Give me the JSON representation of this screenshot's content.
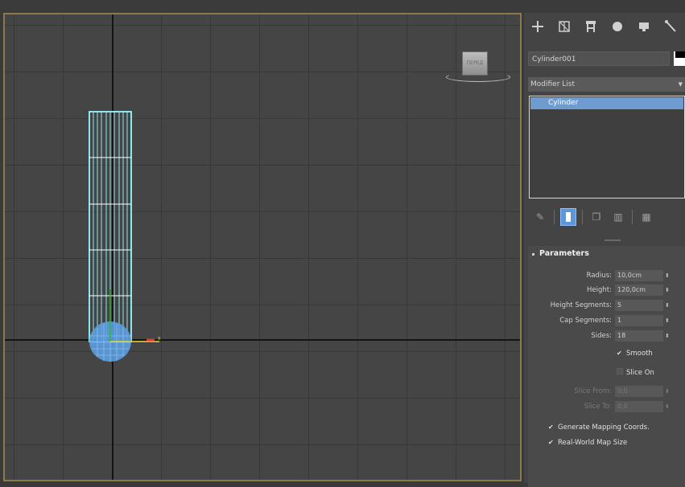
{
  "viewport": {
    "viewcube_label": "ПЕРЕД",
    "object_color": "#8ee6f0",
    "cap_color": "#5b9ee0"
  },
  "panel": {
    "tabs": [
      "create-icon",
      "modify-icon",
      "hierarchy-icon",
      "motion-icon",
      "display-icon",
      "utilities-icon"
    ],
    "object_name": "Cylinder001",
    "object_color": "#ffffff",
    "modifier_list_label": "Modifier List",
    "stack_items": [
      "Cylinder"
    ],
    "rollout_title": "Parameters",
    "params": {
      "radius_label": "Radius:",
      "radius_value": "10,0cm",
      "height_label": "Height:",
      "height_value": "120,0cm",
      "height_segments_label": "Height Segments:",
      "height_segments_value": "5",
      "cap_segments_label": "Cap Segments:",
      "cap_segments_value": "1",
      "sides_label": "Sides:",
      "sides_value": "18",
      "smooth_label": "Smooth",
      "smooth_checked": true,
      "slice_on_label": "Slice On",
      "slice_on_checked": false,
      "slice_from_label": "Slice From:",
      "slice_from_value": "0,0",
      "slice_to_label": "Slice To:",
      "slice_to_value": "0,0",
      "gen_mapping_label": "Generate Mapping Coords.",
      "gen_mapping_checked": true,
      "real_world_label": "Real-World Map Size",
      "real_world_checked": true
    }
  }
}
